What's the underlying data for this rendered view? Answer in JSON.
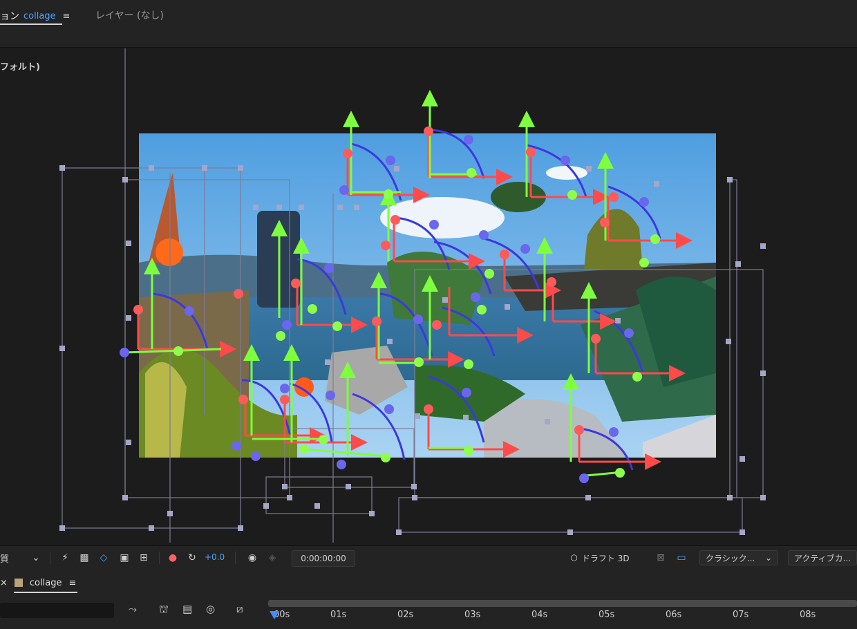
{
  "top_tabs": {
    "composition_prefix": "ョン",
    "composition_name": "collage",
    "menu_glyph": "≡",
    "layer_tab": "レイヤー (なし)"
  },
  "viewer": {
    "camera_label": "フォルト)"
  },
  "viewer_toolbar": {
    "resolution_label": "質",
    "exposure_value": "+0.0",
    "timecode": "0:00:00:00",
    "renderer_label": "ドラフト 3D",
    "renderer_mode": "クラシック...",
    "active_camera": "アクティブカ..."
  },
  "timeline": {
    "close_glyph": "×",
    "comp_tab_label": "collage",
    "menu_glyph": "≡",
    "ruler_ticks": [
      "00s",
      "01s",
      "02s",
      "03s",
      "04s",
      "05s",
      "06s",
      "07s",
      "08s"
    ]
  },
  "colors": {
    "accent_blue": "#4aa3ff",
    "x_axis": "#ff4a4a",
    "y_axis": "#7dff3d",
    "z_axis_arc": "#3b38e0",
    "handle": "#a6a6c8",
    "playhead": "#3f8fff"
  },
  "icons": [
    "dropdown-chevron-icon",
    "fast-preview-icon",
    "transparency-grid-icon",
    "mask-path-icon",
    "region-of-interest-icon",
    "safe-margins-icon",
    "color-channels-icon",
    "reset-exposure-icon",
    "snapshot-icon",
    "show-snapshot-icon",
    "draft3d-cube-icon",
    "grid-3d-icon",
    "view-layout-icon",
    "parent-link-icon",
    "draft3d-timeline-icon",
    "comp-marker-icon",
    "frame-blending-icon",
    "motion-blur-icon",
    "graph-editor-icon"
  ]
}
